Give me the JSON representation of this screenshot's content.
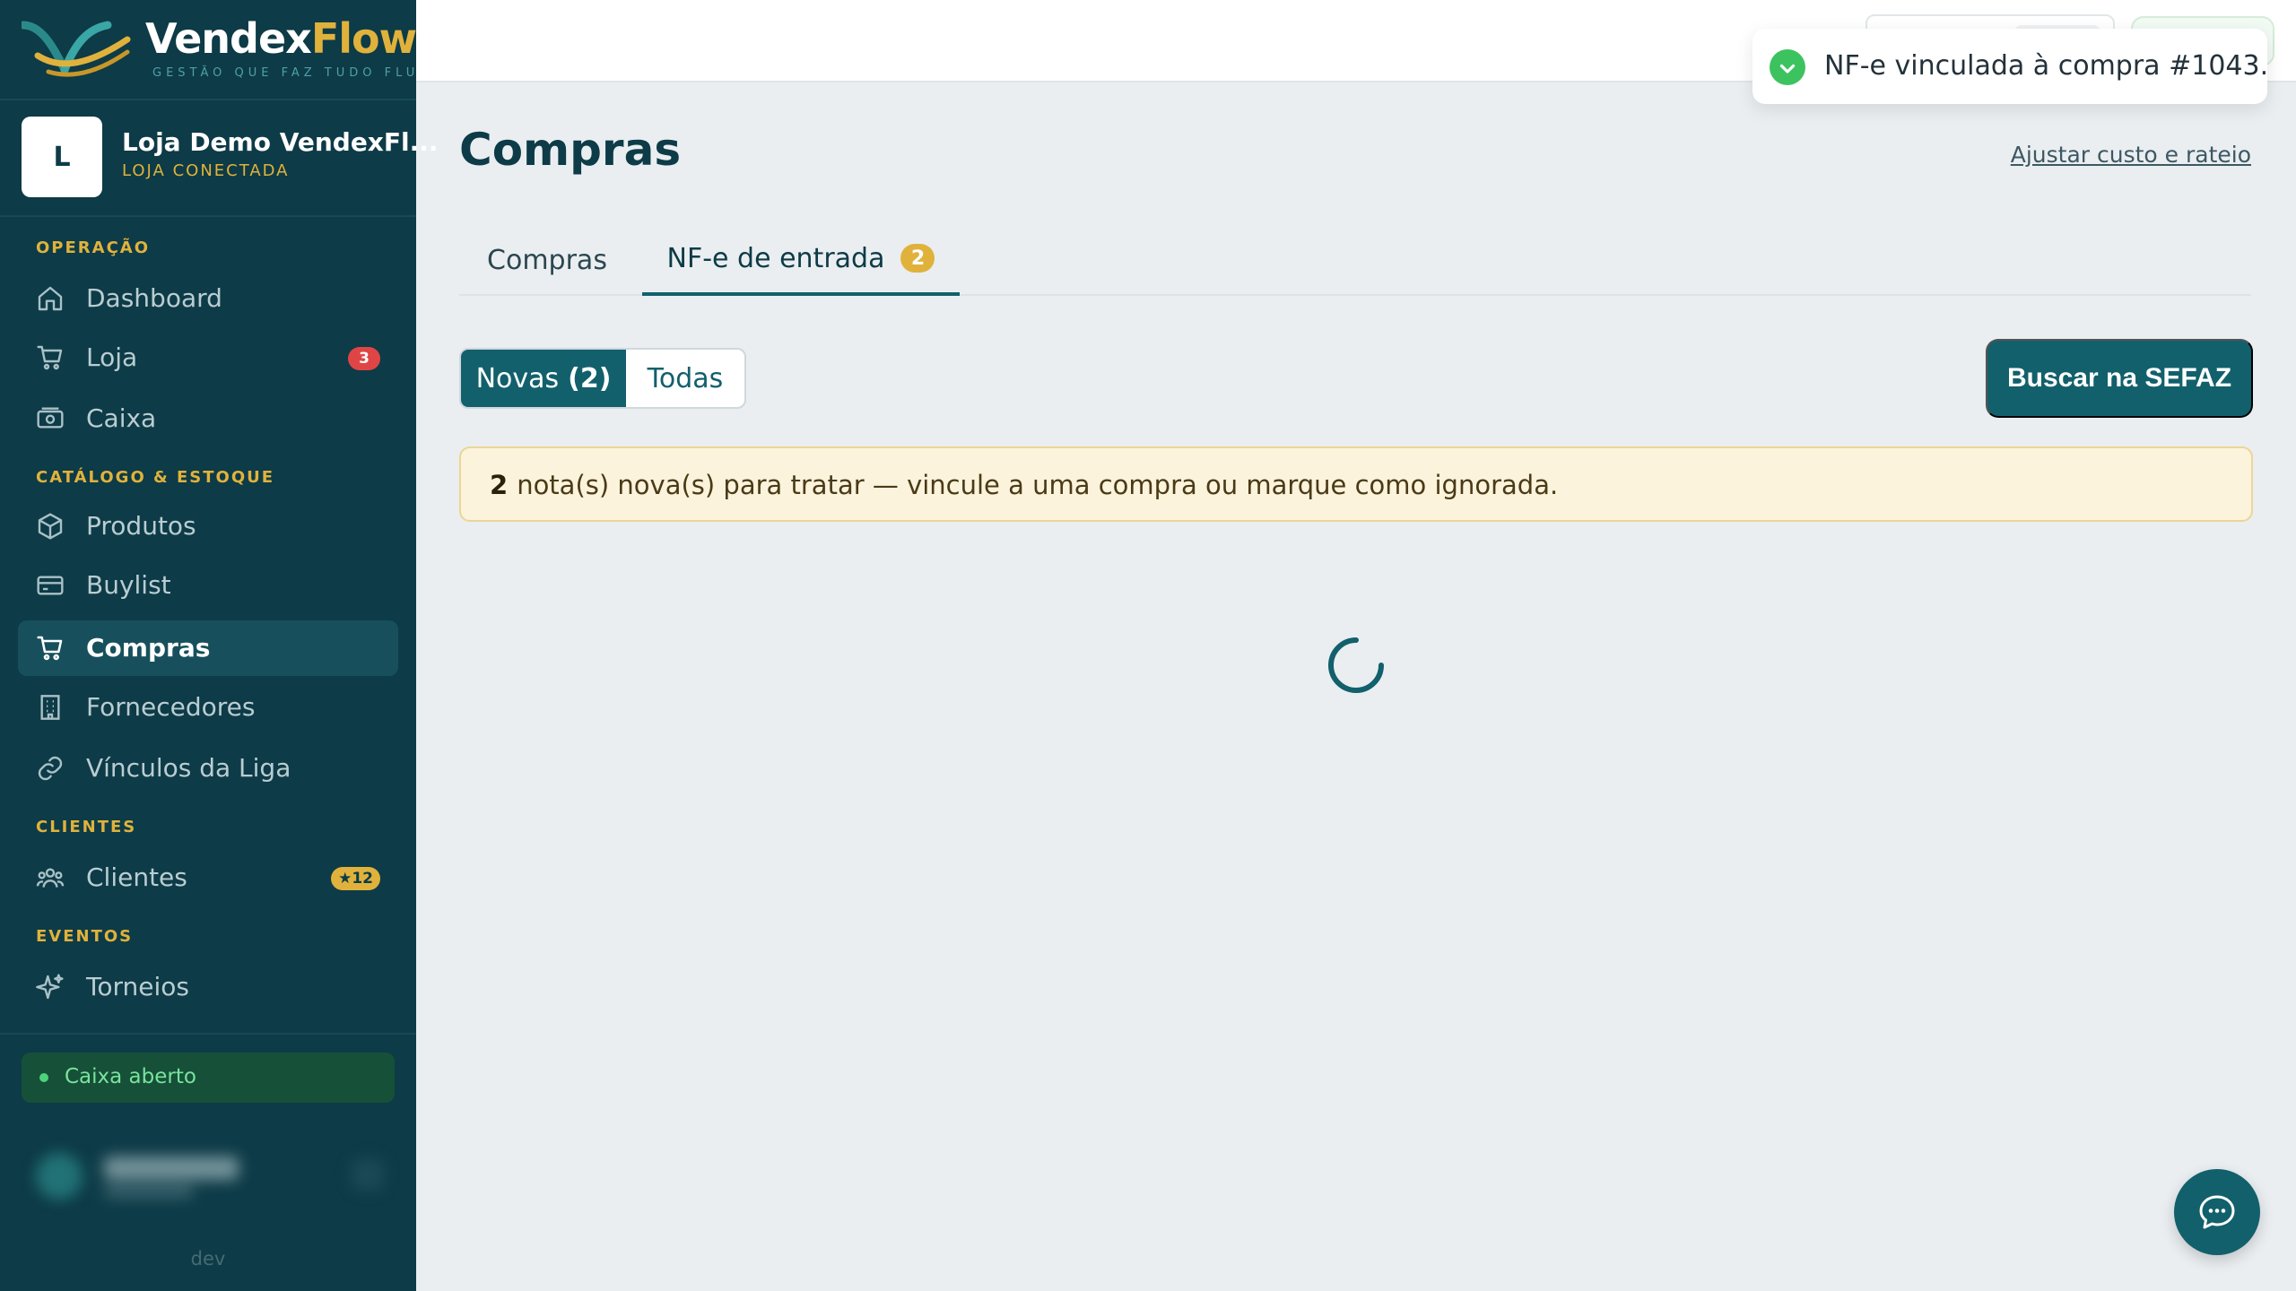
{
  "brand": {
    "name_part1": "Vendex",
    "name_part2": "Flow",
    "tagline": "GESTÃO QUE FAZ TUDO FLUIR"
  },
  "store": {
    "avatar_letter": "L",
    "name": "Loja Demo VendexFl...",
    "status": "LOJA CONECTADA"
  },
  "nav": {
    "sections": [
      {
        "title": "OPERAÇÃO"
      },
      {
        "title": "CATÁLOGO & ESTOQUE"
      },
      {
        "title": "CLIENTES"
      },
      {
        "title": "EVENTOS"
      }
    ],
    "items": [
      {
        "label": "Dashboard",
        "icon": "home-icon"
      },
      {
        "label": "Loja",
        "icon": "cart-icon",
        "badge": "3"
      },
      {
        "label": "Caixa",
        "icon": "cash-icon"
      },
      {
        "label": "Produtos",
        "icon": "box-icon"
      },
      {
        "label": "Buylist",
        "icon": "card-icon"
      },
      {
        "label": "Compras",
        "icon": "cart-icon",
        "active": true
      },
      {
        "label": "Fornecedores",
        "icon": "building-icon"
      },
      {
        "label": "Vínculos da Liga",
        "icon": "link-icon"
      },
      {
        "label": "Clientes",
        "icon": "users-icon",
        "badge": "★12"
      },
      {
        "label": "Torneios",
        "icon": "sparkle-icon"
      }
    ]
  },
  "cash_status": "Caixa aberto",
  "env": "dev",
  "toast": {
    "message": "NF-e vinculada à compra #1043.",
    "icon": "check-circle-icon"
  },
  "page": {
    "title": "Compras",
    "adjust_link": "Ajustar custo e rateio"
  },
  "tabs": [
    {
      "label": "Compras"
    },
    {
      "label": "NF-e de entrada",
      "badge": "2",
      "active": true
    }
  ],
  "filter": {
    "new_label": "Novas",
    "new_count": "(2)",
    "all_label": "Todas"
  },
  "sefaz_button": "Buscar na SEFAZ",
  "notice": {
    "count": "2",
    "text": "nota(s) nova(s) para tratar — vincule a uma compra ou marque como ignorada."
  },
  "colors": {
    "sidebar_bg": "#0d3b47",
    "accent_teal": "#12606c",
    "accent_gold": "#e0b23c",
    "badge_red": "#e04545",
    "success_green": "#3cc35f",
    "notice_bg": "#fbf3dc"
  }
}
